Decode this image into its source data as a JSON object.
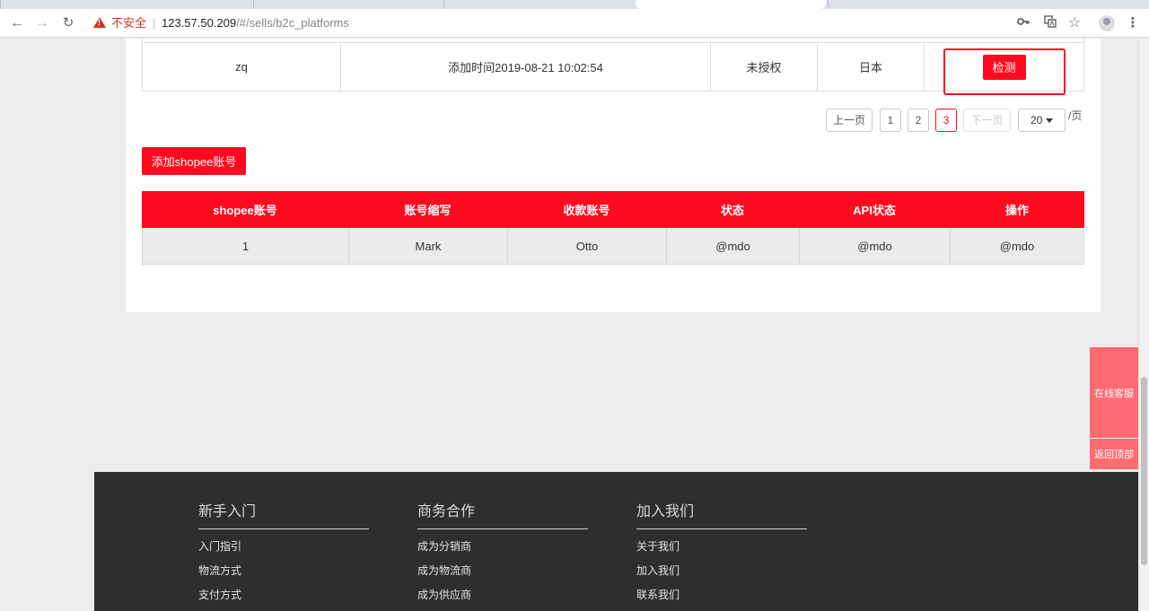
{
  "browser": {
    "insecure_label": "不安全",
    "separator": "|",
    "url_host": "123.57.50.209",
    "url_path": "/#/sells/b2c_platforms"
  },
  "top_table": {
    "row": {
      "account": "zq",
      "added_time": "添加时间2019-08-21 10:02:54",
      "auth_status": "未授权",
      "region": "日本",
      "action_label": "检测"
    }
  },
  "pagination": {
    "prev_label": "上一页",
    "pages": [
      "1",
      "2",
      "3"
    ],
    "current_page": "3",
    "next_label": "下一页",
    "page_size": "20",
    "per_page_suffix": "/页"
  },
  "add_account_label": "添加shopee账号",
  "shopee_table": {
    "headers": [
      "shopee账号",
      "账号缩写",
      "收款账号",
      "状态",
      "API状态",
      "操作"
    ],
    "rows": [
      [
        "1",
        "Mark",
        "Otto",
        "@mdo",
        "@mdo",
        "@mdo"
      ]
    ]
  },
  "float_buttons": {
    "service": "在线客服",
    "back_to_top": "返回顶部"
  },
  "footer": {
    "columns": [
      {
        "title": "新手入门",
        "links": [
          "入门指引",
          "物流方式",
          "支付方式"
        ]
      },
      {
        "title": "商务合作",
        "links": [
          "成为分销商",
          "成为物流商",
          "成为供应商"
        ]
      },
      {
        "title": "加入我们",
        "links": [
          "关于我们",
          "加入我们",
          "联系我们"
        ]
      }
    ]
  },
  "colors": {
    "accent": "#ff0a1e",
    "float_button": "#ff6b72",
    "footer_bg": "#2e2e2e"
  },
  "icons": [
    "back-arrow-icon",
    "forward-arrow-icon",
    "reload-icon",
    "warning-icon",
    "key-icon",
    "translate-icon",
    "star-icon",
    "profile-icon",
    "menu-icon",
    "caret-down-icon"
  ]
}
